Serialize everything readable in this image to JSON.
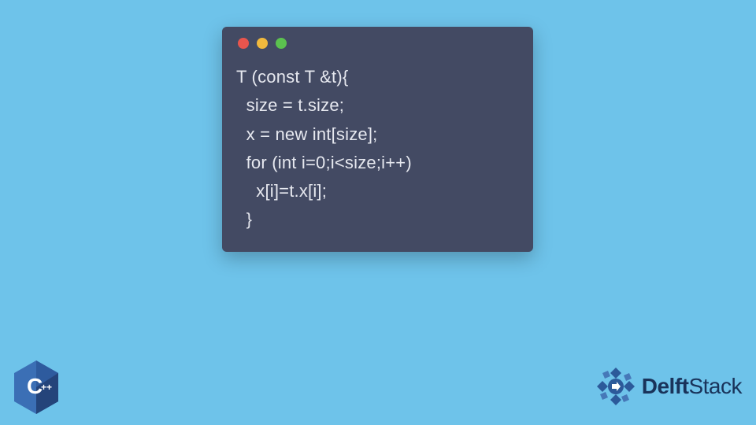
{
  "code": {
    "lines": [
      "T (const T &t){",
      "  size = t.size;",
      "  x = new int[size];",
      "  for (int i=0;i<size;i++)",
      "    x[i]=t.x[i];",
      "  }"
    ]
  },
  "cpp_badge": {
    "letter": "C",
    "plus": "++"
  },
  "brand": {
    "name_part1": "Delft",
    "name_part2": "Stack"
  },
  "colors": {
    "background": "#6ec3ea",
    "window": "#434a63",
    "code_text": "#e6e8ef",
    "traffic_red": "#e8554d",
    "traffic_yellow": "#f1b93d",
    "traffic_green": "#5bc24f",
    "cpp_blue": "#2e5b9e",
    "brand_text": "#19335a"
  }
}
